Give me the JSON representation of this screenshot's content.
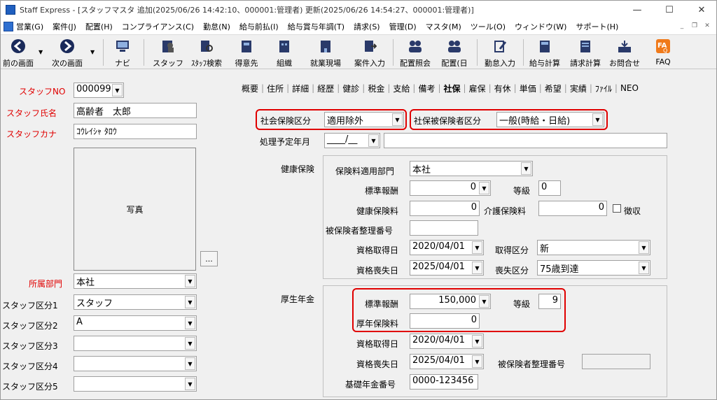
{
  "window": {
    "title": "Staff Express - [スタッフマスタ 追加(2025/06/26 14:42:10、000001:管理者) 更新(2025/06/26 14:54:27、000001:管理者)]"
  },
  "menu": [
    "営業(G)",
    "案件(J)",
    "配置(H)",
    "コンプライアンス(C)",
    "勤怠(N)",
    "給与前払(I)",
    "給与賞与年調(T)",
    "請求(S)",
    "管理(D)",
    "マスタ(M)",
    "ツール(O)",
    "ウィンドウ(W)",
    "サポート(H)"
  ],
  "toolbar": {
    "prev": "前の画面",
    "next": "次の画面",
    "navi": "ナビ",
    "staff": "スタッフ",
    "staff_search": "ｽﾀｯﾌ検索",
    "client": "得意先",
    "org": "組織",
    "site": "就業現場",
    "job_entry": "案件入力",
    "assign_inquiry": "配置照会",
    "assign_day": "配置(日",
    "attendance": "勤怠入力",
    "payroll": "給与計算",
    "billing": "請求計算",
    "inquiry": "お問合せ",
    "faq": "FAQ"
  },
  "left": {
    "staff_no_label": "スタッフNO",
    "staff_no": "000099",
    "name_label": "スタッフ氏名",
    "name": "高齢者　太郎",
    "kana_label": "スタッフカナ",
    "kana": "ｺｳﾚｲｼｬ ﾀﾛｳ",
    "photo_label": "写真",
    "photo_btn": "...",
    "dept_label": "所属部門",
    "dept": "本社",
    "div1_label": "スタッフ区分1",
    "div1": "スタッフ",
    "div2_label": "スタッフ区分2",
    "div2": "A",
    "div3_label": "スタッフ区分3",
    "div3": "",
    "div4_label": "スタッフ区分4",
    "div4": "",
    "div5_label": "スタッフ区分5",
    "div5": ""
  },
  "tabs": [
    "概要",
    "住所",
    "詳細",
    "経歴",
    "健診",
    "税金",
    "支給",
    "備考",
    "社保",
    "雇保",
    "有休",
    "単価",
    "希望",
    "実績",
    "ﾌｧｲﾙ",
    "NEO"
  ],
  "active_tab": "社保",
  "social": {
    "ins_class_label": "社会保険区分",
    "ins_class": "適用除外",
    "insured_class_label": "社保被保険者区分",
    "insured_class": "一般(時給・日給)",
    "plan_label": "処理予定年月",
    "plan_value": "____/__",
    "health": {
      "title": "健康保険",
      "dept_label": "保険料適用部門",
      "dept": "本社",
      "std_label": "標準報酬",
      "std": "0",
      "grade_label": "等級",
      "grade": "0",
      "premium_label": "健康保険料",
      "premium": "0",
      "care_label": "介護保険料",
      "care": "0",
      "collect_label": "徴収",
      "num_label": "被保険者整理番号",
      "num": "",
      "acq_label": "資格取得日",
      "acq": "2020/04/01",
      "acq_div_label": "取得区分",
      "acq_div": "新",
      "loss_label": "資格喪失日",
      "loss": "2025/04/01",
      "loss_div_label": "喪失区分",
      "loss_div": "75歳到達"
    },
    "pension": {
      "title": "厚生年金",
      "std_label": "標準報酬",
      "std": "150,000",
      "grade_label": "等級",
      "grade": "9",
      "premium_label": "厚年保険料",
      "premium": "0",
      "acq_label": "資格取得日",
      "acq": "2020/04/01",
      "loss_label": "資格喪失日",
      "loss": "2025/04/01",
      "num_label": "被保険者整理番号",
      "num": "",
      "basic_label": "基礎年金番号",
      "basic": "0000-123456"
    }
  },
  "colors": {
    "required_label": "#e00000",
    "highlight": "#e00000"
  }
}
